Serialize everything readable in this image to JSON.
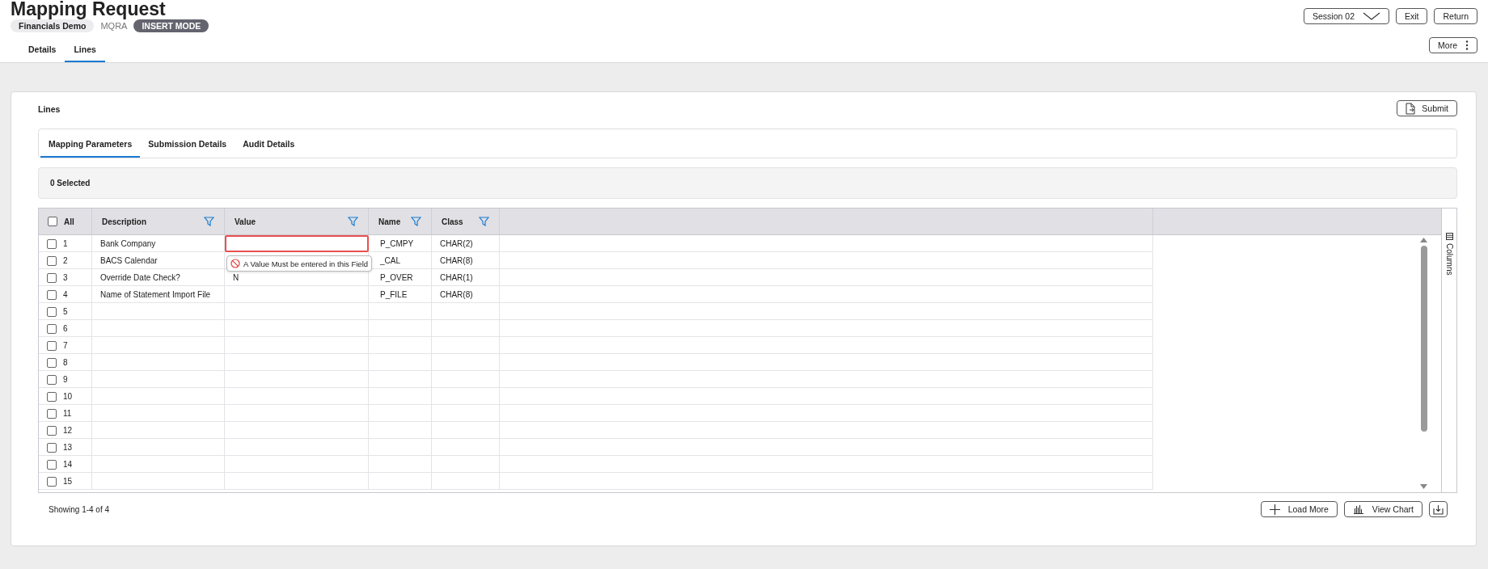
{
  "header": {
    "title": "Mapping Request",
    "company": "Financials Demo",
    "code": "MQRA",
    "mode": "INSERT MODE",
    "session": "Session 02",
    "buttons": [
      "Exit",
      "Return"
    ],
    "more": "More"
  },
  "page_tabs": [
    {
      "label": "Details",
      "selected": false
    },
    {
      "label": "Lines",
      "selected": true
    }
  ],
  "section": {
    "title": "Lines",
    "submit": "Submit"
  },
  "inner_tabs": [
    {
      "label": "Mapping Parameters",
      "selected": true
    },
    {
      "label": "Submission Details",
      "selected": false
    },
    {
      "label": "Audit Details",
      "selected": false
    }
  ],
  "selection": "0 Selected",
  "table": {
    "all": {
      "label": "All",
      "checked": false
    },
    "columns": [
      "Description",
      "Value",
      "Name",
      "Class"
    ],
    "rows": [
      {
        "number": "1",
        "checked": false,
        "description": "Bank Company",
        "value": "",
        "name": "P_CMPY",
        "class": "CHAR(2)",
        "error": true
      },
      {
        "number": "2",
        "checked": false,
        "description": "BACS Calendar",
        "value": "",
        "name": "_CAL",
        "class": "CHAR(8)",
        "error": false
      },
      {
        "number": "3",
        "checked": false,
        "description": "Override Date Check?",
        "value": "N",
        "name": "P_OVER",
        "class": "CHAR(1)",
        "error": false
      },
      {
        "number": "4",
        "checked": false,
        "description": "Name of Statement Import File",
        "value": "",
        "name": "P_FILE",
        "class": "CHAR(8)",
        "error": false
      },
      {
        "number": "5",
        "checked": false
      },
      {
        "number": "6",
        "checked": false
      },
      {
        "number": "7",
        "checked": false
      },
      {
        "number": "8",
        "checked": false
      },
      {
        "number": "9",
        "checked": false
      },
      {
        "number": "10",
        "checked": false
      },
      {
        "number": "11",
        "checked": false
      },
      {
        "number": "12",
        "checked": false
      },
      {
        "number": "13",
        "checked": false
      },
      {
        "number": "14",
        "checked": false
      },
      {
        "number": "15",
        "checked": false
      }
    ],
    "error_message": "A Value Must be entered in this Field",
    "columns_toggle": "Columns",
    "footer": "Showing 1-4 of 4",
    "load_more": "Load More",
    "view_chart": "View Chart"
  }
}
